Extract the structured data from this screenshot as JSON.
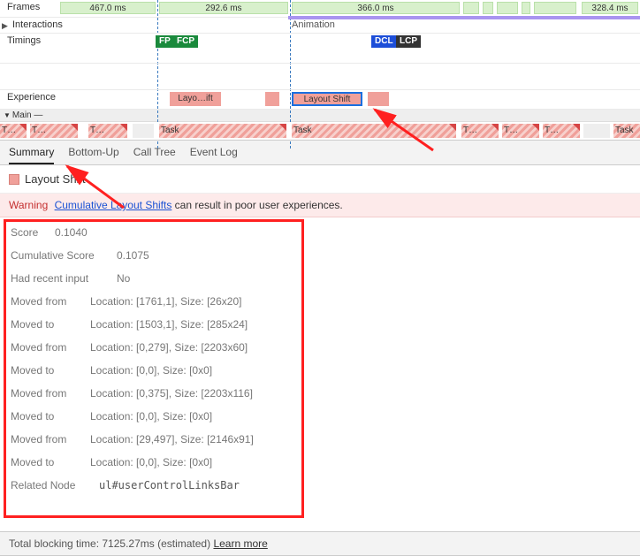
{
  "timeline": {
    "frames_label": "Frames",
    "frames": [
      "467.0 ms",
      "292.6 ms",
      "366.0 ms",
      "328.4 ms"
    ],
    "interactions_label": "Interactions",
    "interactions_note": "Animation",
    "timings_label": "Timings",
    "timings": [
      "FP",
      "FCP",
      "DCL",
      "LCP"
    ],
    "experience_label": "Experience",
    "experience_blocks": [
      "Layo…ift",
      "Layout Shift"
    ],
    "main_label": "Main",
    "tasks": [
      "T…",
      "T…",
      "T…",
      "Task",
      "Task",
      "T…",
      "T…",
      "T…",
      "Task"
    ]
  },
  "tabs": [
    "Summary",
    "Bottom-Up",
    "Call Tree",
    "Event Log"
  ],
  "subheader_title": "Layout Shift",
  "warning": {
    "label": "Warning",
    "link_text": "Cumulative Layout Shifts",
    "suffix": " can result in poor user experiences."
  },
  "details": {
    "score_label": "Score",
    "score_value": "0.1040",
    "cum_label": "Cumulative Score",
    "cum_value": "0.1075",
    "recent_label": "Had recent input",
    "recent_value": "No",
    "moves": [
      {
        "k": "Moved from",
        "v": "Location: [1761,1], Size: [26x20]"
      },
      {
        "k": "Moved to",
        "v": "Location: [1503,1], Size: [285x24]"
      },
      {
        "k": "Moved from",
        "v": "Location: [0,279], Size: [2203x60]"
      },
      {
        "k": "Moved to",
        "v": "Location: [0,0], Size: [0x0]"
      },
      {
        "k": "Moved from",
        "v": "Location: [0,375], Size: [2203x116]"
      },
      {
        "k": "Moved to",
        "v": "Location: [0,0], Size: [0x0]"
      },
      {
        "k": "Moved from",
        "v": "Location: [29,497], Size: [2146x91]"
      },
      {
        "k": "Moved to",
        "v": "Location: [0,0], Size: [0x0]"
      }
    ],
    "related_label": "Related Node",
    "related_value": "ul#userControlLinksBar"
  },
  "footer": {
    "prefix": "Total blocking time: 7125.27ms (estimated) ",
    "link": "Learn more"
  }
}
